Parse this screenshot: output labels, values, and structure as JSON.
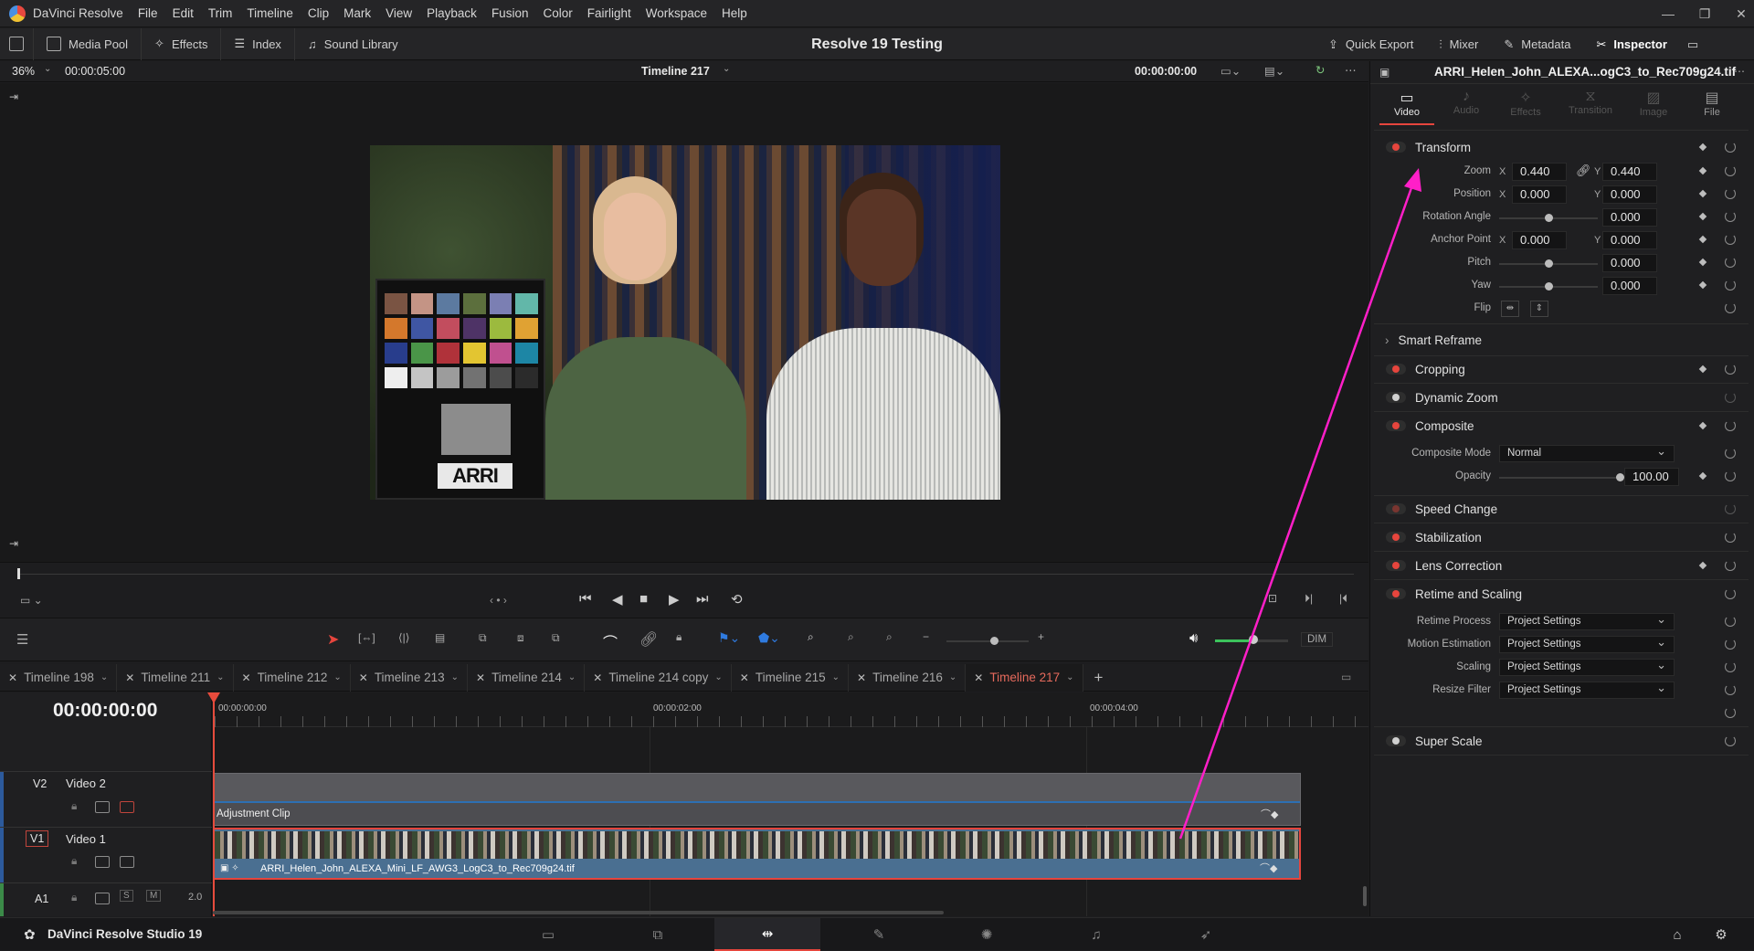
{
  "menubar": {
    "app_name": "DaVinci Resolve",
    "items": [
      "File",
      "Edit",
      "Trim",
      "Timeline",
      "Clip",
      "Mark",
      "View",
      "Playback",
      "Fusion",
      "Color",
      "Fairlight",
      "Workspace",
      "Help"
    ]
  },
  "toolbar": {
    "media_pool": "Media Pool",
    "effects": "Effects",
    "index": "Index",
    "sound_library": "Sound Library",
    "project_title": "Resolve 19 Testing",
    "quick_export": "Quick Export",
    "mixer": "Mixer",
    "metadata": "Metadata",
    "inspector": "Inspector"
  },
  "viewer": {
    "zoom": "36%",
    "duration": "00:00:05:00",
    "timeline_name": "Timeline 217",
    "timecode": "00:00:00:00"
  },
  "transport": {
    "dim_label": "DIM"
  },
  "timeline": {
    "timecode": "00:00:00:00",
    "tabs": [
      "Timeline 198",
      "Timeline 211",
      "Timeline 212",
      "Timeline 213",
      "Timeline 214",
      "Timeline 214 copy",
      "Timeline 215",
      "Timeline 216",
      "Timeline 217"
    ],
    "active_tab": "Timeline 217",
    "ruler": [
      "00:00:00:00",
      "00:00:02:00",
      "00:00:04:00"
    ],
    "tracks": {
      "v2_id": "V2",
      "v2_name": "Video 2",
      "v1_id": "V1",
      "v1_name": "Video 1",
      "a1_id": "A1",
      "a1_channels": "2.0",
      "solo": "S",
      "mute": "M"
    },
    "adjustment_clip": "Adjustment Clip",
    "video_clip": "ARRI_Helen_John_ALEXA_Mini_LF_AWG3_LogC3_to_Rec709g24.tif"
  },
  "inspector": {
    "clip_title": "ARRI_Helen_John_ALEXA...ogC3_to_Rec709g24.tif",
    "tabs": [
      "Video",
      "Audio",
      "Effects",
      "Transition",
      "Image",
      "File"
    ],
    "active_tab": "Video",
    "transform": {
      "title": "Transform",
      "zoom_label": "Zoom",
      "zoom_x": "0.440",
      "zoom_y": "0.440",
      "position_label": "Position",
      "position_x": "0.000",
      "position_y": "0.000",
      "rotation_label": "Rotation Angle",
      "rotation": "0.000",
      "anchor_label": "Anchor Point",
      "anchor_x": "0.000",
      "anchor_y": "0.000",
      "pitch_label": "Pitch",
      "pitch": "0.000",
      "yaw_label": "Yaw",
      "yaw": "0.000",
      "flip_label": "Flip",
      "x": "X",
      "y": "Y"
    },
    "smart_reframe": "Smart Reframe",
    "cropping": "Cropping",
    "dynamic_zoom": "Dynamic Zoom",
    "composite": {
      "title": "Composite",
      "mode_label": "Composite Mode",
      "mode_value": "Normal",
      "opacity_label": "Opacity",
      "opacity": "100.00"
    },
    "speed_change": "Speed Change",
    "stabilization": "Stabilization",
    "lens_correction": "Lens Correction",
    "retime": {
      "title": "Retime and Scaling",
      "process_label": "Retime Process",
      "process_value": "Project Settings",
      "motion_label": "Motion Estimation",
      "motion_value": "Project Settings",
      "scaling_label": "Scaling",
      "scaling_value": "Project Settings",
      "resize_label": "Resize Filter",
      "resize_value": "Project Settings"
    },
    "super_scale": "Super Scale"
  },
  "footer": {
    "product": "DaVinci Resolve Studio 19"
  },
  "colors": {
    "accent_red": "#e6453d",
    "annotation_arrow": "#ff1fc8",
    "clip_blue": "#4a6f91",
    "playhead": "#e64b3c"
  }
}
